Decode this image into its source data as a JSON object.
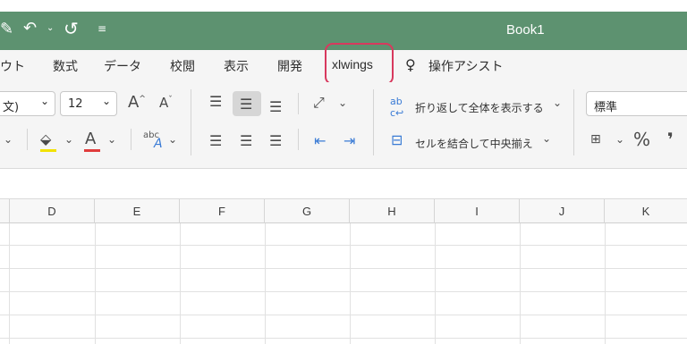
{
  "window": {
    "title": "Book1"
  },
  "quick_access": {
    "undo_icon": "undo-icon",
    "redo_icon": "redo-icon",
    "customize_icon": "customize-icon",
    "edit_icon": "edit-icon"
  },
  "tabs": [
    "ウト",
    "数式",
    "データ",
    "校閲",
    "表示",
    "開発",
    "xlwings",
    "操作アシスト"
  ],
  "ribbon": {
    "font_name": "文)",
    "font_size": "12",
    "wrap_text": "折り返して全体を表示する",
    "merge_center": "セルを結合して中央揃え",
    "number_format": "標準",
    "percent": "%",
    "comma": "❜",
    "font_color": "#e03c3c",
    "fill_color": "#f2e200"
  },
  "columns": [
    "D",
    "E",
    "F",
    "G",
    "H",
    "I",
    "J",
    "K"
  ]
}
